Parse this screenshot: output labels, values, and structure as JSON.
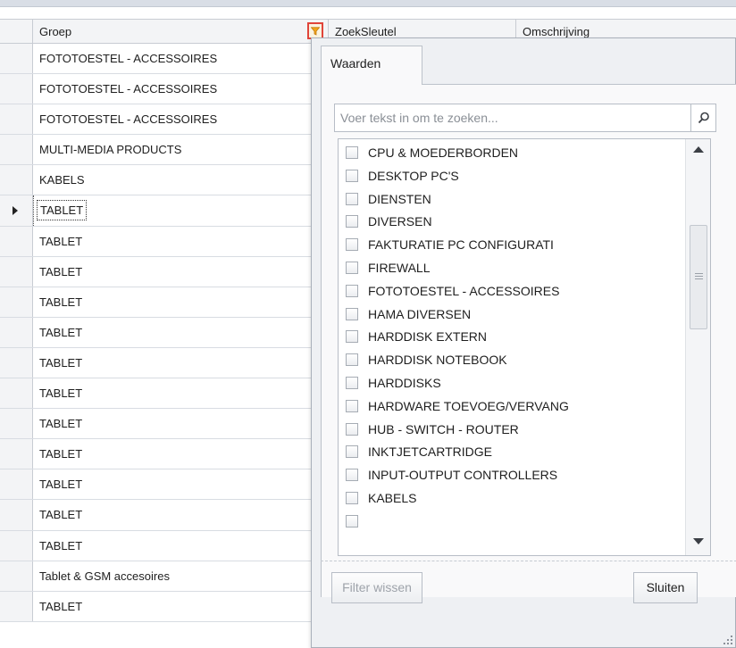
{
  "grid": {
    "columns": [
      "Groep",
      "ZoekSleutel",
      "Omschrijving"
    ],
    "rows": [
      "FOTOTOESTEL - ACCESSOIRES",
      "FOTOTOESTEL - ACCESSOIRES",
      "FOTOTOESTEL - ACCESSOIRES",
      "MULTI-MEDIA PRODUCTS",
      "KABELS",
      "TABLET",
      "TABLET",
      "TABLET",
      "TABLET",
      "TABLET",
      "TABLET",
      "TABLET",
      "TABLET",
      "TABLET",
      "TABLET",
      "TABLET",
      "TABLET",
      "Tablet & GSM accesoires",
      "TABLET"
    ],
    "current_row_index": 5
  },
  "filter_popup": {
    "tab_label": "Waarden",
    "search_placeholder": "Voer tekst in om te zoeken...",
    "search_value": "",
    "values": [
      {
        "label": "CPU & MOEDERBORDEN",
        "checked": false
      },
      {
        "label": "DESKTOP PC'S",
        "checked": false
      },
      {
        "label": "DIENSTEN",
        "checked": false
      },
      {
        "label": "DIVERSEN",
        "checked": false
      },
      {
        "label": "FAKTURATIE PC CONFIGURATI",
        "checked": false
      },
      {
        "label": "FIREWALL",
        "checked": false
      },
      {
        "label": "FOTOTOESTEL - ACCESSOIRES",
        "checked": false
      },
      {
        "label": "HAMA DIVERSEN",
        "checked": false
      },
      {
        "label": "HARDDISK EXTERN",
        "checked": false
      },
      {
        "label": "HARDDISK NOTEBOOK",
        "checked": false
      },
      {
        "label": "HARDDISKS",
        "checked": false
      },
      {
        "label": "HARDWARE TOEVOEG/VERVANG",
        "checked": false
      },
      {
        "label": "HUB - SWITCH - ROUTER",
        "checked": false
      },
      {
        "label": "INKTJETCARTRIDGE",
        "checked": false
      },
      {
        "label": "INPUT-OUTPUT CONTROLLERS",
        "checked": false
      },
      {
        "label": "KABELS",
        "checked": false
      }
    ],
    "clear_button_label": "Filter wissen",
    "close_button_label": "Sluiten",
    "clear_button_enabled": false
  },
  "icons": {
    "filter": "filter-funnel-icon",
    "search": "search-magnifier-icon",
    "row_pointer": "current-row-arrow-icon"
  },
  "colors": {
    "filter_highlight": "#e0443a",
    "filter_funnel": "#f2a51a",
    "header_bg": "#f3f4f6",
    "popup_bg": "#eef0f3"
  }
}
